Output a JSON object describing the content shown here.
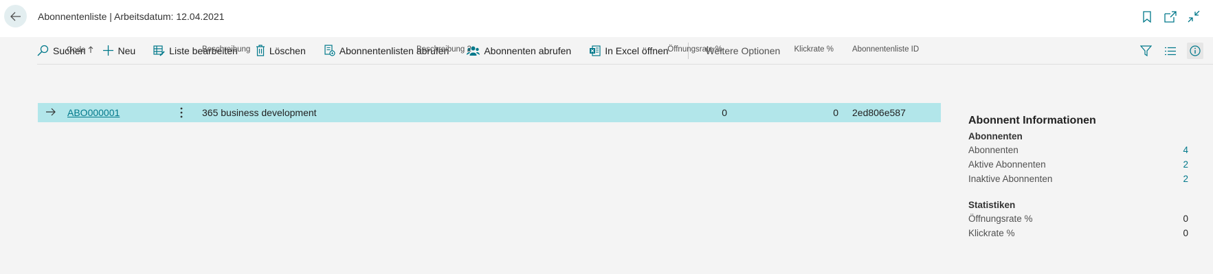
{
  "header": {
    "title": "Abonnentenliste | Arbeitsdatum: 12.04.2021"
  },
  "actions": [
    {
      "label": "Suchen",
      "icon": "search-icon"
    },
    {
      "label": "Neu",
      "icon": "plus-icon"
    },
    {
      "label": "Liste bearbeiten",
      "icon": "edit-list-icon"
    },
    {
      "label": "Löschen",
      "icon": "trash-icon"
    },
    {
      "label": "Abonnentenlisten abrufen",
      "icon": "fetch-list-icon"
    },
    {
      "label": "Abonnenten abrufen",
      "icon": "people-icon"
    },
    {
      "label": "In Excel öffnen",
      "icon": "excel-icon"
    }
  ],
  "more_options": "Weitere Optionen",
  "columns": {
    "code": "Code",
    "description": "Beschreibung",
    "description2": "Beschreibung 2",
    "open_rate": "Öffnungsrate %",
    "click_rate": "Klickrate %",
    "list_id": "Abonnentenliste ID"
  },
  "rows": [
    {
      "code": "ABO000001",
      "description": "365 business development",
      "description2": "",
      "open_rate": "0",
      "click_rate": "0",
      "list_id": "2ed806e587"
    }
  ],
  "factbox": {
    "title": "Abonnent Informationen",
    "group1": "Abonnenten",
    "subscribers_label": "Abonnenten",
    "subscribers_value": "4",
    "active_label": "Aktive Abonnenten",
    "active_value": "2",
    "inactive_label": "Inaktive Abonnenten",
    "inactive_value": "2",
    "group2": "Statistiken",
    "open_rate_label": "Öffnungsrate %",
    "open_rate_value": "0",
    "click_rate_label": "Klickrate %",
    "click_rate_value": "0"
  },
  "colors": {
    "accent": "#00788a",
    "selected_row": "#b2e6ea",
    "content_bg": "#f4f4f4"
  }
}
